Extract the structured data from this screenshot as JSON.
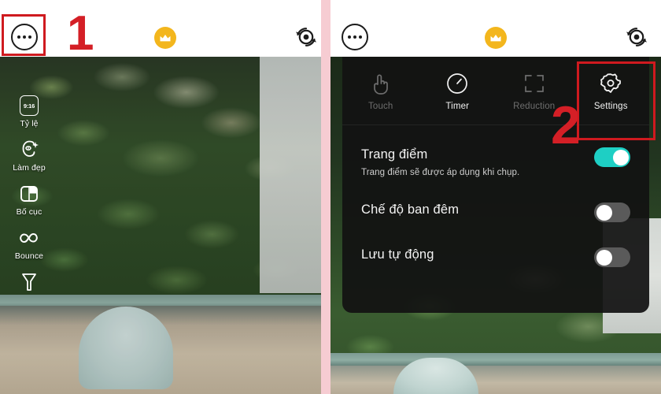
{
  "app": {
    "title": "Camera app settings tutorial",
    "accent_teal": "#1ecfc4",
    "accent_gold": "#f3b61d",
    "annotation_red": "#cf1a1f",
    "panel_background": "#121212",
    "divider_color": "#f6ccd2"
  },
  "left_panel": {
    "topbar": {
      "more_button": "more-options",
      "crown_badge": "premium-crown",
      "flip_camera": "switch-camera"
    },
    "tools": [
      {
        "label": "Tỷ lệ",
        "icon": "aspect-ratio-icon",
        "badge": "9:16"
      },
      {
        "label": "Làm đẹp",
        "icon": "beauty-face-icon",
        "badge": ""
      },
      {
        "label": "Bố cục",
        "icon": "layout-grid-icon",
        "badge": ""
      },
      {
        "label": "Bounce",
        "icon": "bounce-loop-icon",
        "badge": ""
      },
      {
        "label": "",
        "icon": "filter-funnel-icon",
        "badge": ""
      }
    ],
    "annotation": "1"
  },
  "right_panel": {
    "topbar": {
      "more_button": "more-options",
      "crown_badge": "premium-crown",
      "flip_camera": "switch-camera"
    },
    "quick_actions": [
      {
        "label": "Touch",
        "icon": "hand-touch-icon",
        "state": "off"
      },
      {
        "label": "Timer",
        "icon": "timer-clock-icon",
        "state": "on"
      },
      {
        "label": "Reduction",
        "icon": "crop-frame-icon",
        "state": "off"
      },
      {
        "label": "Settings",
        "icon": "gear-icon",
        "state": "on"
      }
    ],
    "settings_rows": [
      {
        "title": "Trang điểm",
        "subtitle": "Trang điểm sẽ được áp dụng khi chụp.",
        "toggle": "on"
      },
      {
        "title": "Chế độ ban đêm",
        "subtitle": "",
        "toggle": "off"
      },
      {
        "title": "Lưu tự động",
        "subtitle": "",
        "toggle": "off"
      }
    ],
    "annotation": "2"
  }
}
